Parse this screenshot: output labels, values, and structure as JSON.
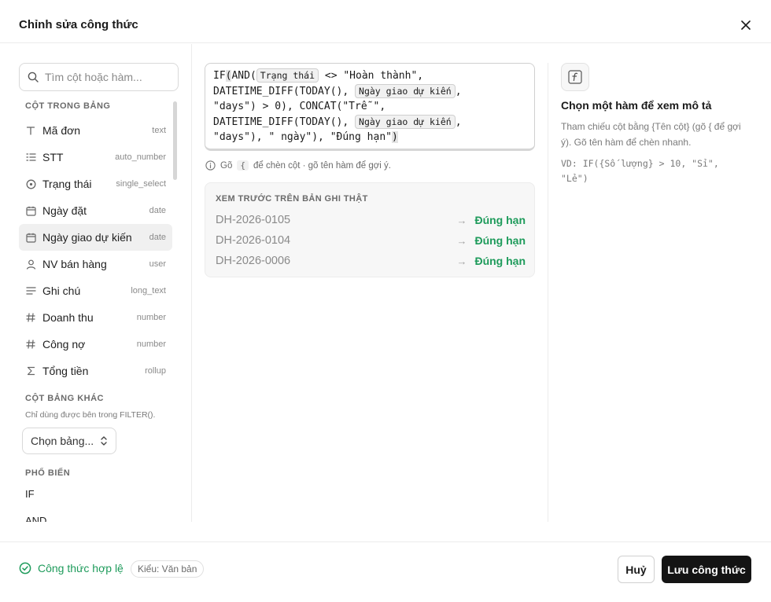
{
  "dialog": {
    "title": "Chỉnh sửa công thức"
  },
  "left": {
    "search_placeholder": "Tìm cột hoặc hàm...",
    "section_columns": "CỘT TRONG BẢNG",
    "columns": [
      {
        "name": "Mã đơn",
        "type": "text",
        "icon": "text-icon"
      },
      {
        "name": "STT",
        "type": "auto_number",
        "icon": "numbered-list-icon"
      },
      {
        "name": "Trạng thái",
        "type": "single_select",
        "icon": "circle-dot-icon"
      },
      {
        "name": "Ngày đặt",
        "type": "date",
        "icon": "calendar-icon"
      },
      {
        "name": "Ngày giao dự kiến",
        "type": "date",
        "icon": "calendar-icon"
      },
      {
        "name": "NV bán hàng",
        "type": "user",
        "icon": "user-icon"
      },
      {
        "name": "Ghi chú",
        "type": "long_text",
        "icon": "lines-icon"
      },
      {
        "name": "Doanh thu",
        "type": "number",
        "icon": "hash-icon"
      },
      {
        "name": "Công nợ",
        "type": "number",
        "icon": "hash-icon"
      },
      {
        "name": "Tổng tiền",
        "type": "rollup",
        "icon": "sigma-icon"
      }
    ],
    "section_other": "CỘT BẢNG KHÁC",
    "other_hint": "Chỉ dùng được bên trong FILTER().",
    "table_select_value": "Chọn bảng...",
    "section_common": "PHỔ BIẾN",
    "common_functions": [
      "IF",
      "AND"
    ]
  },
  "editor": {
    "line1_a": "IF",
    "line1_paren": "(",
    "line1_b": "AND(",
    "chip_status": "Trạng thái",
    "line1_c": " <> \"Hoàn thành\",",
    "line2_a": "DATETIME_DIFF(TODAY(), ",
    "chip_date": "Ngày giao dự kiến",
    "line2_b": ",",
    "line3": "\"days\") > 0), CONCAT(\"Trễ \",",
    "line4_a": "DATETIME_DIFF(TODAY(), ",
    "line4_b": ",",
    "line5_a": "\"days\"), \" ngày\"), \"Đúng hạn\"",
    "line5_paren": ")",
    "hint_a": "Gõ",
    "hint_key": "{",
    "hint_b": "để chèn cột · gõ tên hàm để gợi ý."
  },
  "preview": {
    "title": "XEM TRƯỚC TRÊN BẢN GHI THẬT",
    "rows": [
      {
        "id": "DH-2026-0105",
        "value": "Đúng hạn"
      },
      {
        "id": "DH-2026-0104",
        "value": "Đúng hạn"
      },
      {
        "id": "DH-2026-0006",
        "value": "Đúng hạn"
      }
    ]
  },
  "help": {
    "title": "Chọn một hàm để xem mô tả",
    "description": "Tham chiếu cột bằng {Tên cột} (gõ { để gợi ý). Gõ tên hàm để chèn nhanh.",
    "example": "VD: IF({Số lượng} > 10, \"Sỉ\", \"Lẻ\")"
  },
  "footer": {
    "valid_text": "Công thức hợp lệ",
    "type_badge": "Kiểu: Văn bản",
    "cancel_label": "Huỷ",
    "save_label": "Lưu công thức"
  },
  "colors": {
    "accent_green": "#1e9b5b",
    "primary_button": "#141414"
  }
}
